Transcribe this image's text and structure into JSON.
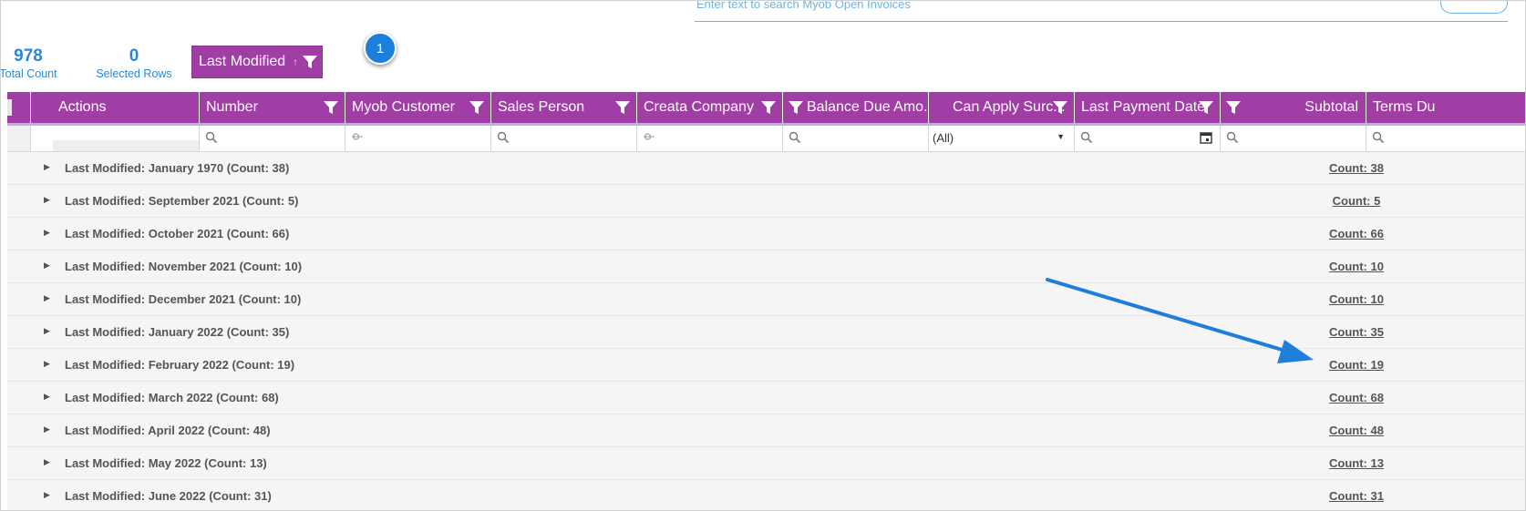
{
  "search": {
    "placeholder": "Enter text to search Myob Open Invoices"
  },
  "counters": {
    "total_count": "978",
    "total_count_label": "Total Count",
    "selected_rows": "0",
    "selected_rows_label": "Selected Rows"
  },
  "group_chip": {
    "label": "Last Modified",
    "sort_arrow": "↑"
  },
  "step_badge": "1",
  "columns": [
    {
      "label": "Actions"
    },
    {
      "label": "Number"
    },
    {
      "label": "Myob Customer"
    },
    {
      "label": "Sales Person"
    },
    {
      "label": "Creata Company"
    },
    {
      "label": "Balance Due Amo..."
    },
    {
      "label": "Can Apply Surc..."
    },
    {
      "label": "Last Payment Date"
    },
    {
      "label": "Subtotal"
    },
    {
      "label": "Terms Du"
    }
  ],
  "filters": {
    "can_apply_select_value": "(All)"
  },
  "groups": [
    {
      "label": "Last Modified: January 1970 (Count: 38)",
      "count": "Count: 38"
    },
    {
      "label": "Last Modified: September 2021 (Count: 5)",
      "count": "Count: 5"
    },
    {
      "label": "Last Modified: October 2021 (Count: 66)",
      "count": "Count: 66"
    },
    {
      "label": "Last Modified: November 2021 (Count: 10)",
      "count": "Count: 10"
    },
    {
      "label": "Last Modified: December 2021 (Count: 10)",
      "count": "Count: 10"
    },
    {
      "label": "Last Modified: January 2022 (Count: 35)",
      "count": "Count: 35"
    },
    {
      "label": "Last Modified: February 2022 (Count: 19)",
      "count": "Count: 19"
    },
    {
      "label": "Last Modified: March 2022 (Count: 68)",
      "count": "Count: 68"
    },
    {
      "label": "Last Modified: April 2022 (Count: 48)",
      "count": "Count: 48"
    },
    {
      "label": "Last Modified: May 2022 (Count: 13)",
      "count": "Count: 13"
    },
    {
      "label": "Last Modified: June 2022 (Count: 31)",
      "count": "Count: 31"
    }
  ],
  "colors": {
    "header_bg": "#a03ea6",
    "accent_blue": "#2b88d8",
    "arrow_blue": "#1e7fdb"
  }
}
